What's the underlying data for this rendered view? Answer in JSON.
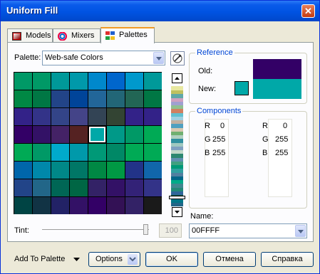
{
  "window": {
    "title": "Uniform Fill",
    "close": "✕"
  },
  "tabs": [
    {
      "label": "Models",
      "icon": "models-icon"
    },
    {
      "label": "Mixers",
      "icon": "mixers-icon"
    },
    {
      "label": "Palettes",
      "icon": "palettes-icon"
    }
  ],
  "palette": {
    "label": "Palette:",
    "value": "Web-safe Colors"
  },
  "reference": {
    "title": "Reference",
    "old_label": "Old:",
    "new_label": "New:",
    "old_color": "#330066",
    "new_color": "#00a8a8"
  },
  "components": {
    "title": "Components",
    "left": [
      {
        "k": "R",
        "v": "0"
      },
      {
        "k": "G",
        "v": "255"
      },
      {
        "k": "B",
        "v": "255"
      }
    ],
    "right": [
      {
        "k": "R",
        "v": "0"
      },
      {
        "k": "G",
        "v": "255"
      },
      {
        "k": "B",
        "v": "255"
      }
    ]
  },
  "name_field": {
    "label": "Name:",
    "value": "00FFFF"
  },
  "tint": {
    "label": "Tint:",
    "value": "100"
  },
  "buttons": {
    "add_to_palette": "Add To Palette",
    "options": "Options",
    "ok": "OK",
    "cancel": "Отмена",
    "help": "Справка"
  },
  "grid_colors": [
    [
      "#009966",
      "#009966",
      "#009999",
      "#0099aa",
      "#0088cc",
      "#0066cc",
      "#0099cc",
      "#009999"
    ],
    [
      "#008844",
      "#007744",
      "#224488",
      "#004499",
      "#226699",
      "#226677",
      "#226655",
      "#007744"
    ],
    [
      "#332288",
      "#333388",
      "#334488",
      "#444488",
      "#334455",
      "#334433",
      "#332288",
      "#332288"
    ],
    [
      "#330066",
      "#331166",
      "#442266",
      "#552222",
      "#00a8a8",
      "#009988",
      "#009966",
      "#00aa55"
    ],
    [
      "#00aa55",
      "#009966",
      "#00aacc",
      "#0099aa",
      "#009977",
      "#008866",
      "#00aa55",
      "#00aa55"
    ],
    [
      "#0066aa",
      "#0088aa",
      "#008888",
      "#007766",
      "#008844",
      "#009944",
      "#223388",
      "#1166aa"
    ],
    [
      "#224488",
      "#226688",
      "#006655",
      "#006644",
      "#332266",
      "#331166",
      "#332277",
      "#333388"
    ],
    [
      "#004444",
      "#113344",
      "#222266",
      "#331166",
      "#330066",
      "#331155",
      "#332266",
      "#1a1a1a"
    ]
  ],
  "strip_colors": [
    "#e8e8a0",
    "#c0c060",
    "#60a8a8",
    "#d0a0c0",
    "#a0a0d0",
    "#90c090",
    "#d08060",
    "#60c0d0",
    "#a0d0e0",
    "#c0b0a0",
    "#50a0c0",
    "#d8c8b0",
    "#70b070",
    "#b0d0c0",
    "#3090a0",
    "#a0c8c0",
    "#80a0c0",
    "#c0d8c8",
    "#2c8870",
    "#6090b0",
    "#40a080",
    "#009977",
    "#30a0a0",
    "#5080a0",
    "#006688",
    "#00aa88",
    "#408890",
    "#228877",
    "#306699",
    "#005544",
    "#007788",
    "#226688"
  ]
}
